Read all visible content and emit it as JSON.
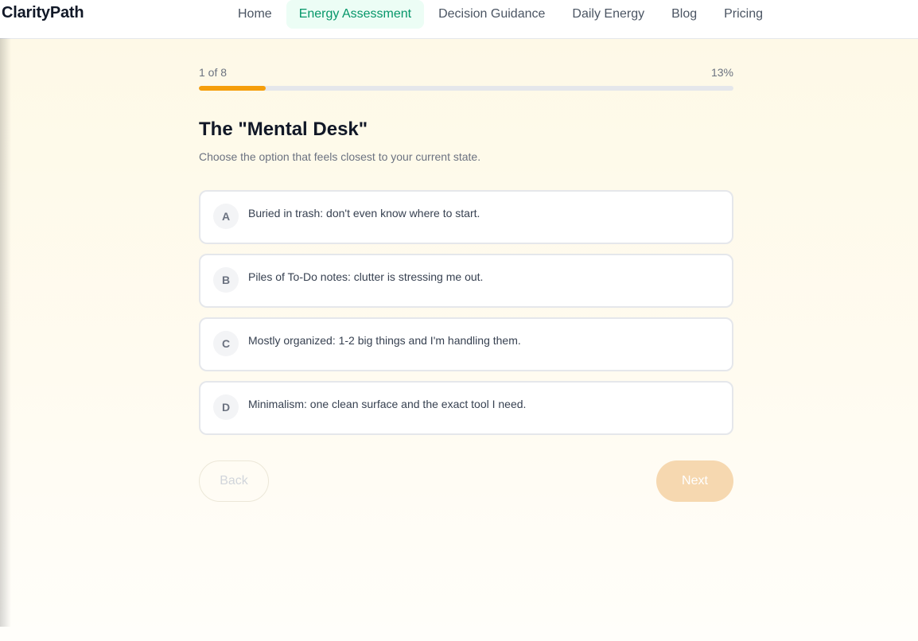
{
  "app": {
    "logo": "ClarityPath"
  },
  "nav": {
    "items": [
      {
        "label": "Home",
        "active": false
      },
      {
        "label": "Energy Assessment",
        "active": true
      },
      {
        "label": "Decision Guidance",
        "active": false
      },
      {
        "label": "Daily Energy",
        "active": false
      },
      {
        "label": "Blog",
        "active": false
      },
      {
        "label": "Pricing",
        "active": false
      }
    ]
  },
  "progress": {
    "step_text": "1 of 8",
    "percent_text": "13%",
    "fraction": 0.125
  },
  "question": {
    "title": "The \"Mental Desk\"",
    "subtitle": "Choose the option that feels closest to your current state.",
    "options": [
      {
        "letter": "A",
        "text": "Buried in trash: don't even know where to start."
      },
      {
        "letter": "B",
        "text": "Piles of To-Do notes: clutter is stressing me out."
      },
      {
        "letter": "C",
        "text": "Mostly organized: 1-2 big things and I'm handling them."
      },
      {
        "letter": "D",
        "text": "Minimalism: one clean surface and the exact tool I need."
      }
    ]
  },
  "buttons": {
    "back": "Back",
    "next": "Next"
  },
  "colors": {
    "accent": "#f59e0b",
    "active_nav_bg": "#ecfdf5",
    "active_nav_text": "#059669",
    "next_disabled_bg": "#f6d8b0"
  }
}
